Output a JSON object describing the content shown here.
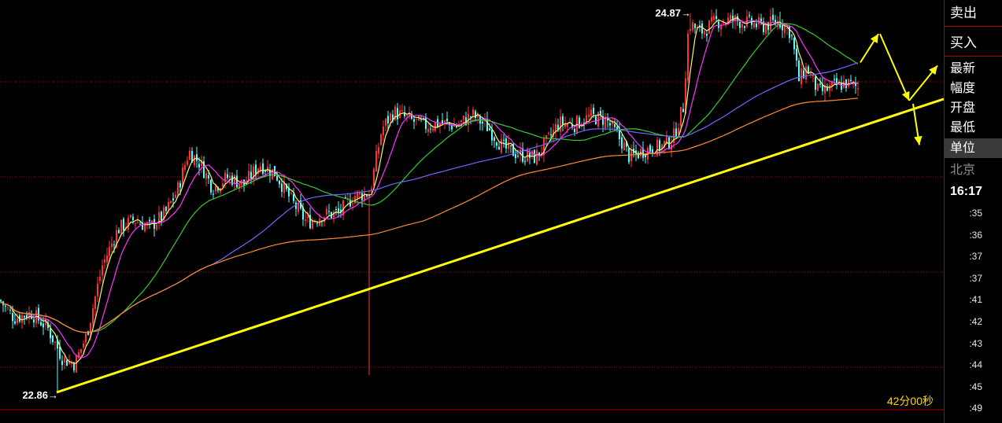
{
  "chart_data": {
    "type": "candlestick",
    "price_high_label": "24.87→",
    "price_low_label": "22.86→",
    "high": 24.87,
    "low": 22.86,
    "timer_text": "42分00秒",
    "colors": {
      "up": "#ff3232",
      "down": "#54ffff",
      "ma_short": "#f5f57a",
      "ma_mid": "#ff33ff",
      "ma_long": "#33cc33",
      "ma_longer": "#6a6aff",
      "ma_longest": "#ff8a33",
      "trendline": "#ffff00",
      "grid": "#b00000"
    },
    "path_anchors": [
      [
        0,
        23.44
      ],
      [
        18,
        23.33
      ],
      [
        40,
        23.36
      ],
      [
        60,
        23.27
      ],
      [
        80,
        23.07
      ],
      [
        95,
        23.04
      ],
      [
        110,
        23.22
      ],
      [
        130,
        23.66
      ],
      [
        150,
        23.89
      ],
      [
        170,
        23.95
      ],
      [
        190,
        23.9
      ],
      [
        210,
        23.99
      ],
      [
        225,
        24.13
      ],
      [
        240,
        24.38
      ],
      [
        255,
        24.3
      ],
      [
        270,
        24.15
      ],
      [
        290,
        24.22
      ],
      [
        310,
        24.17
      ],
      [
        330,
        24.3
      ],
      [
        350,
        24.24
      ],
      [
        370,
        24.07
      ],
      [
        390,
        23.93
      ],
      [
        410,
        23.98
      ],
      [
        430,
        23.99
      ],
      [
        450,
        24.1
      ],
      [
        470,
        24.12
      ],
      [
        485,
        24.52
      ],
      [
        500,
        24.63
      ],
      [
        520,
        24.58
      ],
      [
        540,
        24.54
      ],
      [
        560,
        24.56
      ],
      [
        580,
        24.54
      ],
      [
        600,
        24.61
      ],
      [
        620,
        24.53
      ],
      [
        640,
        24.4
      ],
      [
        660,
        24.36
      ],
      [
        680,
        24.34
      ],
      [
        695,
        24.44
      ],
      [
        710,
        24.56
      ],
      [
        730,
        24.55
      ],
      [
        750,
        24.6
      ],
      [
        770,
        24.58
      ],
      [
        790,
        24.44
      ],
      [
        800,
        24.34
      ],
      [
        820,
        24.39
      ],
      [
        840,
        24.41
      ],
      [
        855,
        24.46
      ],
      [
        868,
        24.66
      ],
      [
        875,
        25.19
      ],
      [
        890,
        25.13
      ],
      [
        910,
        25.2
      ],
      [
        930,
        25.21
      ],
      [
        950,
        25.19
      ],
      [
        970,
        25.17
      ],
      [
        990,
        25.2
      ],
      [
        1005,
        25.13
      ],
      [
        1015,
        24.83
      ],
      [
        1025,
        24.91
      ],
      [
        1040,
        24.75
      ],
      [
        1060,
        24.79
      ],
      [
        1075,
        24.81
      ],
      [
        1090,
        24.78
      ]
    ],
    "trendline_points": [
      [
        72,
        22.86
      ],
      [
        1199,
        24.71
      ]
    ],
    "annotation_arrows": [
      [
        [
          1093,
          24.94
        ],
        [
          1116,
          25.12
        ]
      ],
      [
        [
          1118,
          25.12
        ],
        [
          1155,
          24.7
        ]
      ],
      [
        [
          1155,
          24.7
        ],
        [
          1191,
          24.92
        ]
      ],
      [
        [
          1160,
          24.68
        ],
        [
          1168,
          24.42
        ]
      ]
    ]
  },
  "sidebar": {
    "sell_label": "卖出",
    "buy_label": "买入",
    "fields": [
      "最新",
      "幅度",
      "开盘",
      "最低"
    ],
    "unit_label": "单位",
    "city_label": "北京",
    "time_bold": "16:17",
    "time_ticks": [
      ":35",
      ":36",
      ":37",
      ":37",
      ":41",
      ":42",
      ":43",
      ":44",
      ":45",
      ":49"
    ]
  }
}
